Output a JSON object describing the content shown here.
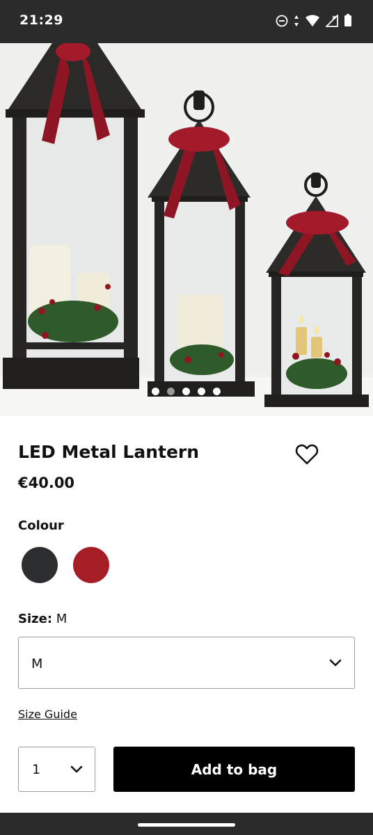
{
  "status_bar": {
    "time": "21:29",
    "icons": [
      "do-not-disturb-icon",
      "data-arrows-icon",
      "wifi-icon",
      "signal-icon",
      "battery-icon"
    ]
  },
  "gallery": {
    "image_subject": "three black metal lanterns with red velvet bows and candles",
    "image_count": 5,
    "active_index": 1
  },
  "product": {
    "title": "LED Metal Lantern",
    "price": "€40.00"
  },
  "colour": {
    "label": "Colour",
    "options": [
      {
        "name": "black",
        "hex": "#2c2d30"
      },
      {
        "name": "red",
        "hex": "#a71d26"
      }
    ]
  },
  "size": {
    "label": "Size:",
    "current": "M",
    "selected": "M"
  },
  "size_guide": "Size Guide",
  "quantity": {
    "value": "1"
  },
  "add_to_bag": "Add to bag"
}
